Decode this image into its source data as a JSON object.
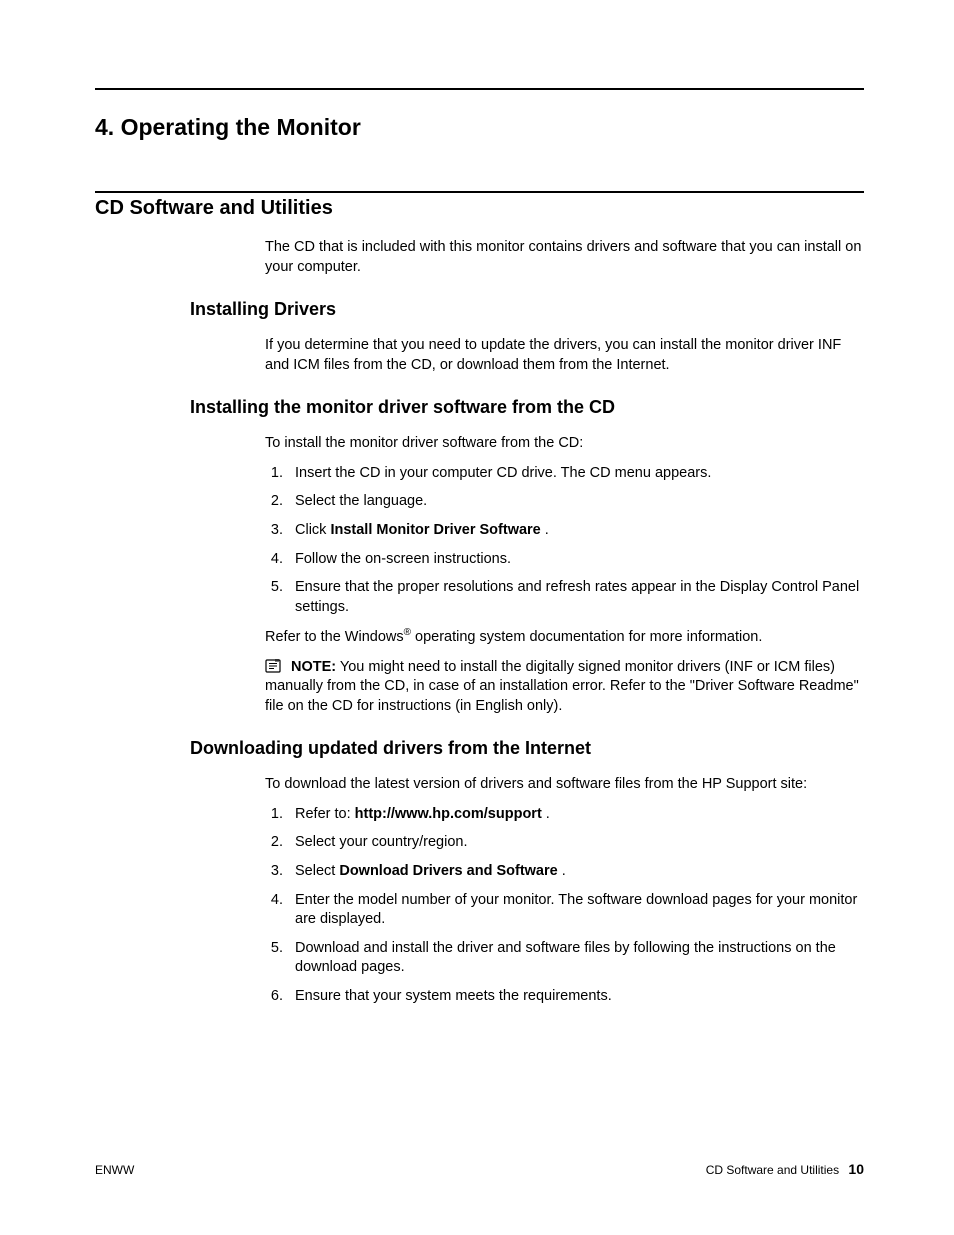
{
  "chapter_title": "4. Operating the Monitor",
  "section_title": "CD Software and Utilities",
  "section_intro": "The CD that is included with this monitor contains drivers and software that you can install on your computer.",
  "sub1": {
    "title": "Installing Drivers",
    "text": "If you determine that you need to update the drivers, you can install the monitor driver INF and ICM files from the CD, or download them from the Internet."
  },
  "sub2": {
    "title": "Installing the monitor driver software from the CD",
    "intro": "To install the monitor driver software from the CD:",
    "steps": [
      "Insert the CD in your computer CD drive. The CD menu appears.",
      "Select the language.",
      {
        "prefix": "Click ",
        "bold": "Install Monitor Driver Software",
        "suffix": " ."
      },
      "Follow the on-screen instructions.",
      "Ensure that the proper resolutions and refresh rates appear in the Display Control Panel settings."
    ],
    "after_pre": "Refer to the Windows",
    "after_sup": "®",
    "after_post": " operating system documentation for more information.",
    "note_label": "NOTE:",
    "note_text": " You might need to install the digitally signed monitor drivers (INF or ICM files) manually from the CD, in case of an installation error. Refer to the \"Driver Software Readme\" file on the CD for instructions (in English only)."
  },
  "sub3": {
    "title": "Downloading updated drivers from the Internet",
    "intro": "To download the latest version of drivers and software files from the HP Support site:",
    "steps": [
      {
        "prefix": "Refer to: ",
        "bold": "http://www.hp.com/support",
        "suffix": " ."
      },
      "Select your country/region.",
      {
        "prefix": "Select ",
        "bold": "Download Drivers and Software",
        "suffix": " ."
      },
      "Enter the model number of your monitor. The software download pages for your monitor are displayed.",
      "Download and install the driver and software files by following the instructions on the download pages.",
      "Ensure that your system meets the requirements."
    ]
  },
  "footer": {
    "left": "ENWW",
    "right_label": "CD Software and Utilities",
    "page": "10"
  }
}
